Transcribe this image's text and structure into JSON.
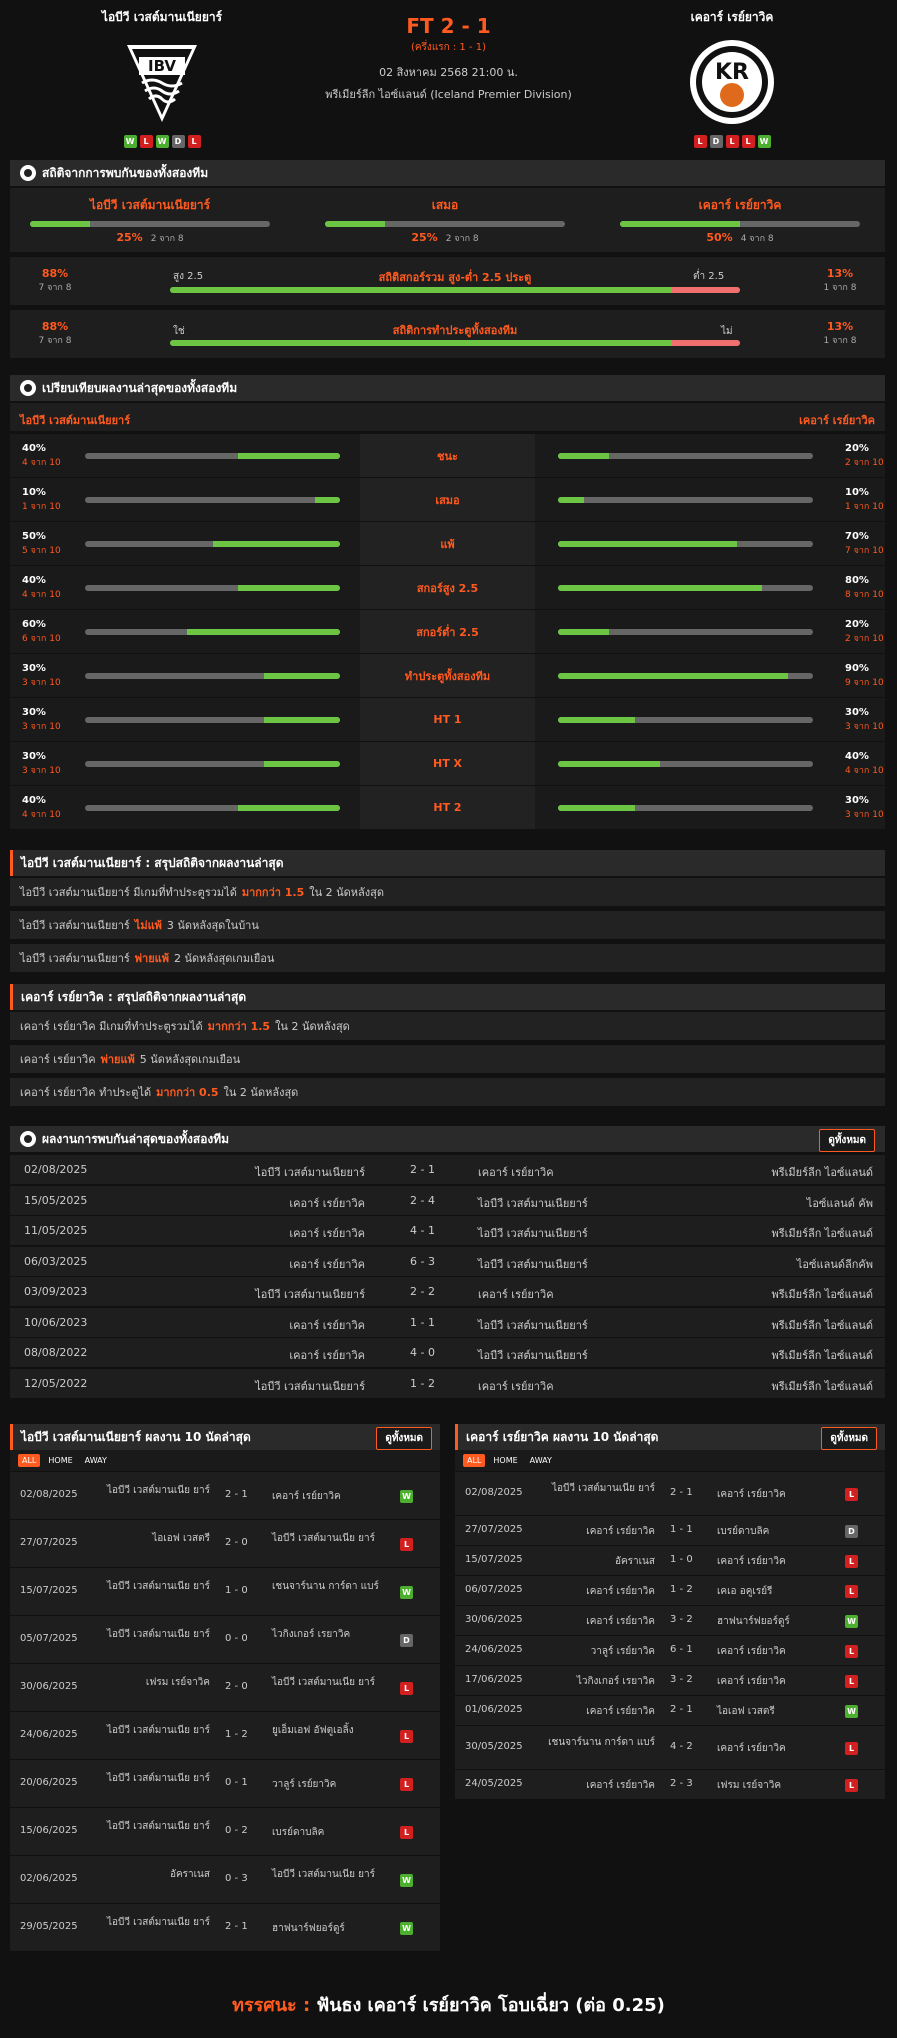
{
  "match": {
    "home": "ไอบีวี เวสต์มานเนียยาร์",
    "away": "เคอาร์ เรย์ยาวิค",
    "score": "FT 2 - 1",
    "half": "(ครึ่งแรก : 1 - 1)",
    "date": "02 สิงหาคม 2568 21:00 น.",
    "league": "พรีเมียร์ลีก ไอซ์แลนด์ (Iceland Premier Division)",
    "home_form": [
      "W",
      "L",
      "W",
      "D",
      "L"
    ],
    "away_form": [
      "L",
      "D",
      "L",
      "L",
      "W"
    ]
  },
  "h2h_stats": {
    "title": "สถิติจากการพบกันของทั้งสองทีม",
    "cols": [
      {
        "label": "ไอบีวี เวสต์มานเนียยาร์",
        "pct": "25%",
        "sub": "2 จาก 8",
        "frac": 0.25
      },
      {
        "label": "เสมอ",
        "pct": "25%",
        "sub": "2 จาก 8",
        "frac": 0.25
      },
      {
        "label": "เคอาร์ เรย์ยาวิค",
        "pct": "50%",
        "sub": "4 จาก 8",
        "frac": 0.5
      }
    ],
    "ou": {
      "lpct": "88%",
      "lsub": "7 จาก 8",
      "lname": "สูง 2.5",
      "title": "สถิติสกอร์รวม สูง-ต่ำ 2.5 ประตู",
      "rname": "ต่ำ 2.5",
      "rpct": "13%",
      "rsub": "1 จาก 8",
      "frac": 0.88
    },
    "btts": {
      "lpct": "88%",
      "lsub": "7 จาก 8",
      "lname": "ใช่",
      "title": "สถิติการทำประตูทั้งสองทีม",
      "rname": "ไม่",
      "rpct": "13%",
      "rsub": "1 จาก 8",
      "frac": 0.88
    }
  },
  "compare": {
    "title": "เปรียบเทียบผลงานล่าสุดของทั้งสองทีม",
    "home": "ไอบีวี เวสต์มานเนียยาร์",
    "away": "เคอาร์ เรย์ยาวิค",
    "rows": [
      {
        "label": "ชนะ",
        "lv": "40%",
        "ls": "4 จาก 10",
        "lf": 0.4,
        "rv": "20%",
        "rs": "2 จาก 10",
        "rf": 0.2
      },
      {
        "label": "เสมอ",
        "lv": "10%",
        "ls": "1 จาก 10",
        "lf": 0.1,
        "rv": "10%",
        "rs": "1 จาก 10",
        "rf": 0.1
      },
      {
        "label": "แพ้",
        "lv": "50%",
        "ls": "5 จาก 10",
        "lf": 0.5,
        "rv": "70%",
        "rs": "7 จาก 10",
        "rf": 0.7
      },
      {
        "label": "สกอร์สูง 2.5",
        "lv": "40%",
        "ls": "4 จาก 10",
        "lf": 0.4,
        "rv": "80%",
        "rs": "8 จาก 10",
        "rf": 0.8
      },
      {
        "label": "สกอร์ต่ำ 2.5",
        "lv": "60%",
        "ls": "6 จาก 10",
        "lf": 0.6,
        "rv": "20%",
        "rs": "2 จาก 10",
        "rf": 0.2
      },
      {
        "label": "ทำประตูทั้งสองทีม",
        "lv": "30%",
        "ls": "3 จาก 10",
        "lf": 0.3,
        "rv": "90%",
        "rs": "9 จาก 10",
        "rf": 0.9
      },
      {
        "label": "HT 1",
        "lv": "30%",
        "ls": "3 จาก 10",
        "lf": 0.3,
        "rv": "30%",
        "rs": "3 จาก 10",
        "rf": 0.3
      },
      {
        "label": "HT X",
        "lv": "30%",
        "ls": "3 จาก 10",
        "lf": 0.3,
        "rv": "40%",
        "rs": "4 จาก 10",
        "rf": 0.4
      },
      {
        "label": "HT 2",
        "lv": "40%",
        "ls": "4 จาก 10",
        "lf": 0.4,
        "rv": "30%",
        "rs": "3 จาก 10",
        "rf": 0.3
      }
    ]
  },
  "home_summary": {
    "title": "ไอบีวี เวสต์มานเนียยาร์ : สรุปสถิติจากผลงานล่าสุด",
    "rows": [
      {
        "a": "ไอบีวี เวสต์มานเนียยาร์  มีเกมที่ทำประตูรวมได้",
        "hl": "มากกว่า  1.5",
        "b": "ใน 2 นัดหลังสุด"
      },
      {
        "a": "ไอบีวี เวสต์มานเนียยาร์",
        "hl": "ไม่แพ้",
        "b": "3  นัดหลังสุดในบ้าน"
      },
      {
        "a": "ไอบีวี เวสต์มานเนียยาร์",
        "hl": "พ่ายแพ้",
        "b": "2  นัดหลังสุดเกมเยือน"
      }
    ]
  },
  "away_summary": {
    "title": "เคอาร์ เรย์ยาวิค : สรุปสถิติจากผลงานล่าสุด",
    "rows": [
      {
        "a": "เคอาร์ เรย์ยาวิค  มีเกมที่ทำประตูรวมได้",
        "hl": "มากกว่า  1.5",
        "b": "ใน 2 นัดหลังสุด"
      },
      {
        "a": "เคอาร์ เรย์ยาวิค",
        "hl": "พ่ายแพ้",
        "b": "5  นัดหลังสุดเกมเยือน"
      },
      {
        "a": "เคอาร์ เรย์ยาวิค  ทำประตูได้",
        "hl": "มากกว่า  0.5",
        "b": "ใน 2 นัดหลังสุด"
      }
    ]
  },
  "h2h": {
    "title": "ผลงานการพบกันล่าสุดของทั้งสองทีม",
    "btn": "ดูทั้งหมด",
    "rows": [
      {
        "d": "02/08/2025",
        "h": "ไอบีวี เวสต์มานเนียยาร์",
        "s": "2 - 1",
        "a": "เคอาร์ เรย์ยาวิค",
        "l": "พรีเมียร์ลีก ไอซ์แลนด์"
      },
      {
        "d": "15/05/2025",
        "h": "เคอาร์ เรย์ยาวิค",
        "s": "2 - 4",
        "a": "ไอบีวี เวสต์มานเนียยาร์",
        "l": "ไอซ์แลนด์ คัพ"
      },
      {
        "d": "11/05/2025",
        "h": "เคอาร์ เรย์ยาวิค",
        "s": "4 - 1",
        "a": "ไอบีวี เวสต์มานเนียยาร์",
        "l": "พรีเมียร์ลีก ไอซ์แลนด์"
      },
      {
        "d": "06/03/2025",
        "h": "เคอาร์ เรย์ยาวิค",
        "s": "6 - 3",
        "a": "ไอบีวี เวสต์มานเนียยาร์",
        "l": "ไอซ์แลนด์ลีกคัพ"
      },
      {
        "d": "03/09/2023",
        "h": "ไอบีวี เวสต์มานเนียยาร์",
        "s": "2 - 2",
        "a": "เคอาร์ เรย์ยาวิค",
        "l": "พรีเมียร์ลีก ไอซ์แลนด์"
      },
      {
        "d": "10/06/2023",
        "h": "เคอาร์ เรย์ยาวิค",
        "s": "1 - 1",
        "a": "ไอบีวี เวสต์มานเนียยาร์",
        "l": "พรีเมียร์ลีก ไอซ์แลนด์"
      },
      {
        "d": "08/08/2022",
        "h": "เคอาร์ เรย์ยาวิค",
        "s": "4 - 0",
        "a": "ไอบีวี เวสต์มานเนียยาร์",
        "l": "พรีเมียร์ลีก ไอซ์แลนด์"
      },
      {
        "d": "12/05/2022",
        "h": "ไอบีวี เวสต์มานเนียยาร์",
        "s": "1 - 2",
        "a": "เคอาร์ เรย์ยาวิค",
        "l": "พรีเมียร์ลีก ไอซ์แลนด์"
      }
    ]
  },
  "tabs": [
    "ALL",
    "HOME",
    "AWAY"
  ],
  "home_last": {
    "title": "ไอบีวี เวสต์มานเนียยาร์ ผลงาน 10 นัดล่าสุด",
    "btn": "ดูทั้งหมด",
    "rows": [
      {
        "d": "02/08/2025",
        "h": "ไอบีวี เวสต์มานเนีย ยาร์",
        "s": "2 - 1",
        "a": "เคอาร์ เรย์ยาวิค",
        "r": "W"
      },
      {
        "d": "27/07/2025",
        "h": "ไอเอฟ เวสตรี",
        "s": "2 - 0",
        "a": "ไอบีวี เวสต์มานเนีย ยาร์",
        "r": "L"
      },
      {
        "d": "15/07/2025",
        "h": "ไอบีวี เวสต์มานเนีย ยาร์",
        "s": "1 - 0",
        "a": "เชนจาร์นาน การ์ดา แบร์",
        "r": "W"
      },
      {
        "d": "05/07/2025",
        "h": "ไอบีวี เวสต์มานเนีย ยาร์",
        "s": "0 - 0",
        "a": "ไวกิงเกอร์ เรยาวิค",
        "r": "D"
      },
      {
        "d": "30/06/2025",
        "h": "เฟรม เรย์จาวิค",
        "s": "2 - 0",
        "a": "ไอบีวี เวสต์มานเนีย ยาร์",
        "r": "L"
      },
      {
        "d": "24/06/2025",
        "h": "ไอบีวี เวสต์มานเนีย ยาร์",
        "s": "1 - 2",
        "a": "ยูเอ็มเอฟ อัฟตูเอลิ้ง",
        "r": "L"
      },
      {
        "d": "20/06/2025",
        "h": "ไอบีวี เวสต์มานเนีย ยาร์",
        "s": "0 - 1",
        "a": "วาลูร์ เรย์ยาวิค",
        "r": "L"
      },
      {
        "d": "15/06/2025",
        "h": "ไอบีวี เวสต์มานเนีย ยาร์",
        "s": "0 - 2",
        "a": "เบรย์ดาบลิค",
        "r": "L"
      },
      {
        "d": "02/06/2025",
        "h": "อัคราเนส",
        "s": "0 - 3",
        "a": "ไอบีวี เวสต์มานเนีย ยาร์",
        "r": "W"
      },
      {
        "d": "29/05/2025",
        "h": "ไอบีวี เวสต์มานเนีย ยาร์",
        "s": "2 - 1",
        "a": "ฮาฟนาร์ฟยอร์ดูร์",
        "r": "W"
      }
    ]
  },
  "away_last": {
    "title": "เคอาร์ เรย์ยาวิค ผลงาน 10 นัดล่าสุด",
    "btn": "ดูทั้งหมด",
    "rows": [
      {
        "d": "02/08/2025",
        "h": "ไอบีวี เวสต์มานเนีย ยาร์",
        "s": "2 - 1",
        "a": "เคอาร์ เรย์ยาวิค",
        "r": "L"
      },
      {
        "d": "27/07/2025",
        "h": "เคอาร์ เรย์ยาวิค",
        "s": "1 - 1",
        "a": "เบรย์ดาบลิค",
        "r": "D"
      },
      {
        "d": "15/07/2025",
        "h": "อัคราเนส",
        "s": "1 - 0",
        "a": "เคอาร์ เรย์ยาวิค",
        "r": "L"
      },
      {
        "d": "06/07/2025",
        "h": "เคอาร์ เรย์ยาวิค",
        "s": "1 - 2",
        "a": "เคเอ อคูเรย์รี",
        "r": "L"
      },
      {
        "d": "30/06/2025",
        "h": "เคอาร์ เรย์ยาวิค",
        "s": "3 - 2",
        "a": "ฮาฟนาร์ฟยอร์ดูร์",
        "r": "W"
      },
      {
        "d": "24/06/2025",
        "h": "วาลูร์ เรย์ยาวิค",
        "s": "6 - 1",
        "a": "เคอาร์ เรย์ยาวิค",
        "r": "L"
      },
      {
        "d": "17/06/2025",
        "h": "ไวกิงเกอร์ เรยาวิค",
        "s": "3 - 2",
        "a": "เคอาร์ เรย์ยาวิค",
        "r": "L"
      },
      {
        "d": "01/06/2025",
        "h": "เคอาร์ เรย์ยาวิค",
        "s": "2 - 1",
        "a": "ไอเอฟ เวสตรี",
        "r": "W"
      },
      {
        "d": "30/05/2025",
        "h": "เชนจาร์นาน การ์ดา แบร์",
        "s": "4 - 2",
        "a": "เคอาร์ เรย์ยาวิค",
        "r": "L"
      },
      {
        "d": "24/05/2025",
        "h": "เคอาร์ เรย์ยาวิค",
        "s": "2 - 3",
        "a": "เฟรม เรย์จาวิค",
        "r": "L"
      }
    ]
  },
  "verdict": {
    "label": "ทรรศนะ :",
    "text": "ฟันธง เคอาร์ เรย์ยาวิค โอบเฉี่ยว (ต่อ 0.25)"
  },
  "colors": {
    "accent": "#ff5a1f",
    "bar_green": "#6cc644",
    "bar_red": "#f07070",
    "win": "#4caf2f",
    "loss": "#d21f1f",
    "draw": "#666666"
  }
}
